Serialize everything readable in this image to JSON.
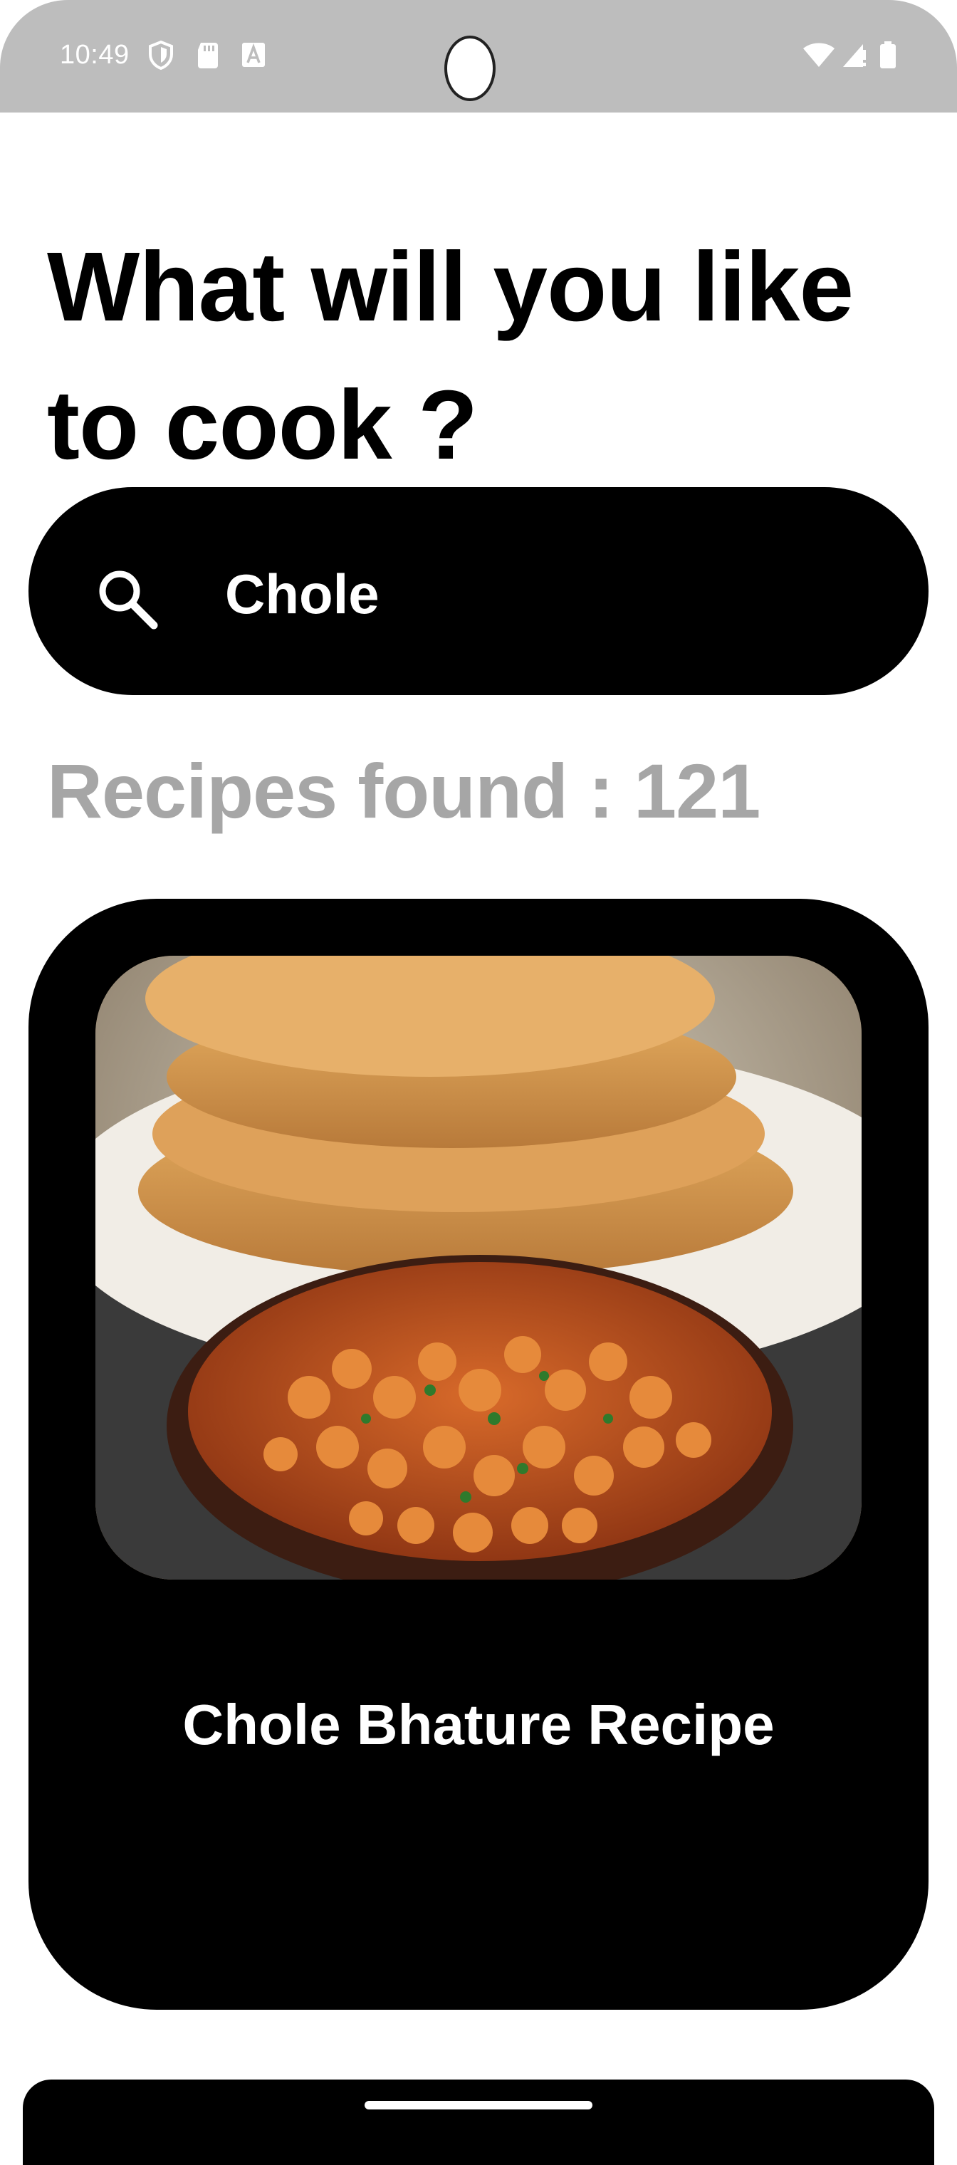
{
  "status_bar": {
    "time": "10:49",
    "icons": [
      "shield-icon",
      "sd-card-icon",
      "font-a-icon",
      "wifi-icon",
      "signal-icon",
      "battery-icon"
    ]
  },
  "headline": "What will you like to cook ?",
  "search": {
    "value": "Chole",
    "icon": "search-icon"
  },
  "results": {
    "count_label": "Recipes found : 121"
  },
  "recipes": [
    {
      "title": "Chole Bhature Recipe",
      "image": "chole-bhature-photo"
    }
  ],
  "colors": {
    "card_bg": "#000000",
    "count_text": "#a6a6a6",
    "status_bar_bg": "#bdbdbd"
  }
}
